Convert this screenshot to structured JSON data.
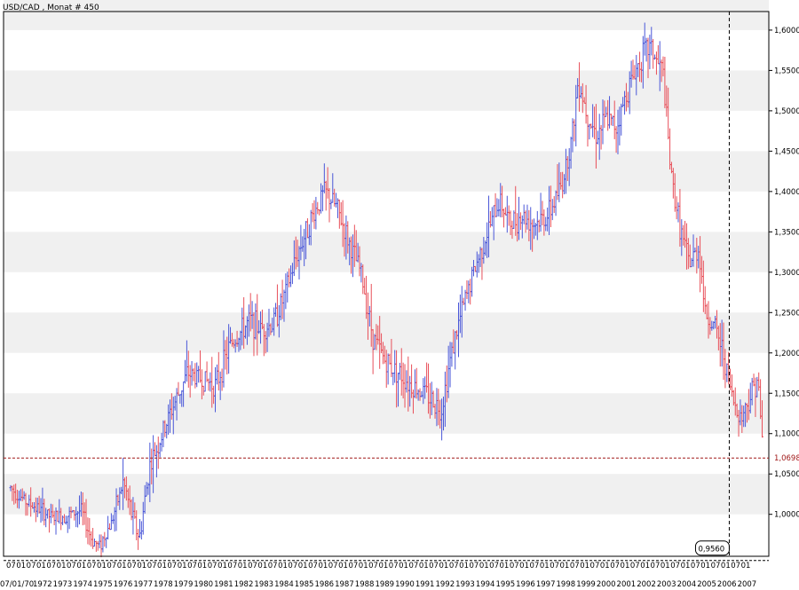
{
  "window_title": "USD/CAD , Monat # 450",
  "chart_data": {
    "type": "ohlc-bar",
    "title": "USD/CAD , Monat # 450",
    "instrument": "USD/CAD",
    "period": "Monat",
    "bar_count": "450",
    "ylim": [
      0.948,
      1.623
    ],
    "y_ticks": [
      1.0,
      1.05,
      1.1,
      1.15,
      1.2,
      1.25,
      1.3,
      1.35,
      1.4,
      1.45,
      1.5,
      1.55,
      1.6
    ],
    "y_tick_labels": [
      "1,0000",
      "1,0500",
      "1,1000",
      "1,1500",
      "1,2000",
      "1,2500",
      "1,3000",
      "1,3500",
      "1,4000",
      "1,4500",
      "1,5000",
      "1,5500",
      "1,6000"
    ],
    "x_start": 1970.5,
    "x_end": 2007.9,
    "x_top_labels": [
      "07",
      "01",
      "07",
      "01",
      "07",
      "01",
      "07",
      "01",
      "07",
      "01",
      "07",
      "01",
      "07",
      "01",
      "07",
      "01",
      "07",
      "01",
      "07",
      "01",
      "07",
      "01",
      "07",
      "01",
      "07",
      "01",
      "07",
      "01",
      "07",
      "01",
      "07",
      "01",
      "07",
      "01",
      "07",
      "01",
      "07",
      "01",
      "07",
      "01",
      "07",
      "01",
      "07",
      "01",
      "07",
      "01",
      "07",
      "01",
      "07",
      "01",
      "07",
      "01",
      "07",
      "01",
      "07",
      "01",
      "07",
      "01",
      "07",
      "01",
      "07",
      "01",
      "07",
      "01",
      "07",
      "01",
      "07",
      "01",
      "07",
      "01",
      "07",
      "01",
      "07",
      "01"
    ],
    "x_bottom_labels": [
      "07/01/70",
      "1972",
      "1973",
      "1974",
      "1975",
      "1976",
      "1977",
      "1978",
      "1979",
      "1980",
      "1981",
      "1982",
      "1983",
      "1984",
      "1985",
      "1986",
      "1987",
      "1988",
      "1989",
      "1990",
      "1991",
      "1992",
      "1993",
      "1994",
      "1995",
      "1996",
      "1997",
      "1998",
      "1999",
      "2000",
      "2001",
      "2002",
      "2003",
      "2004",
      "2005",
      "2006",
      "2007"
    ],
    "current_price": 1.0698,
    "current_price_label": "1,0698",
    "low_marker": 0.956,
    "low_marker_label": "0,9560",
    "crosshair_year": 2006.2,
    "up_color": "#4a57d8",
    "down_color": "#e8505a",
    "band_color": "#f0f0f0",
    "price_line_color": "#a01818",
    "path_waypoints": [
      [
        1970.5,
        1.033
      ],
      [
        1971.3,
        1.015
      ],
      [
        1972.0,
        1.005
      ],
      [
        1972.6,
        0.995
      ],
      [
        1973.5,
        1.0
      ],
      [
        1974.0,
        1.005
      ],
      [
        1974.5,
        0.97
      ],
      [
        1974.9,
        0.96
      ],
      [
        1975.5,
        0.99
      ],
      [
        1976.1,
        1.04
      ],
      [
        1976.5,
        1.0
      ],
      [
        1976.9,
        0.97
      ],
      [
        1977.4,
        1.06
      ],
      [
        1977.9,
        1.09
      ],
      [
        1978.5,
        1.13
      ],
      [
        1979.3,
        1.175
      ],
      [
        1979.8,
        1.17
      ],
      [
        1980.7,
        1.16
      ],
      [
        1981.4,
        1.21
      ],
      [
        1982.4,
        1.24
      ],
      [
        1982.9,
        1.23
      ],
      [
        1983.5,
        1.235
      ],
      [
        1984.1,
        1.27
      ],
      [
        1984.7,
        1.32
      ],
      [
        1985.5,
        1.37
      ],
      [
        1986.1,
        1.4
      ],
      [
        1986.7,
        1.38
      ],
      [
        1987.4,
        1.33
      ],
      [
        1987.9,
        1.3
      ],
      [
        1988.5,
        1.22
      ],
      [
        1989.1,
        1.19
      ],
      [
        1989.8,
        1.175
      ],
      [
        1990.4,
        1.16
      ],
      [
        1991.1,
        1.15
      ],
      [
        1991.9,
        1.13
      ],
      [
        1992.4,
        1.2
      ],
      [
        1992.9,
        1.25
      ],
      [
        1993.5,
        1.3
      ],
      [
        1994.2,
        1.35
      ],
      [
        1994.8,
        1.39
      ],
      [
        1995.3,
        1.36
      ],
      [
        1995.9,
        1.37
      ],
      [
        1996.5,
        1.36
      ],
      [
        1997.2,
        1.37
      ],
      [
        1997.9,
        1.41
      ],
      [
        1998.4,
        1.47
      ],
      [
        1998.7,
        1.54
      ],
      [
        1999.1,
        1.5
      ],
      [
        1999.6,
        1.47
      ],
      [
        2000.1,
        1.49
      ],
      [
        2000.6,
        1.48
      ],
      [
        2001.2,
        1.53
      ],
      [
        2001.9,
        1.57
      ],
      [
        2002.3,
        1.58
      ],
      [
        2002.6,
        1.56
      ],
      [
        2002.9,
        1.55
      ],
      [
        2003.3,
        1.42
      ],
      [
        2003.8,
        1.35
      ],
      [
        2004.2,
        1.31
      ],
      [
        2004.7,
        1.33
      ],
      [
        2005.0,
        1.25
      ],
      [
        2005.5,
        1.23
      ],
      [
        2005.9,
        1.2
      ],
      [
        2006.4,
        1.14
      ],
      [
        2006.8,
        1.12
      ],
      [
        2007.3,
        1.15
      ],
      [
        2007.6,
        1.17
      ],
      [
        2007.9,
        1.07
      ]
    ]
  }
}
